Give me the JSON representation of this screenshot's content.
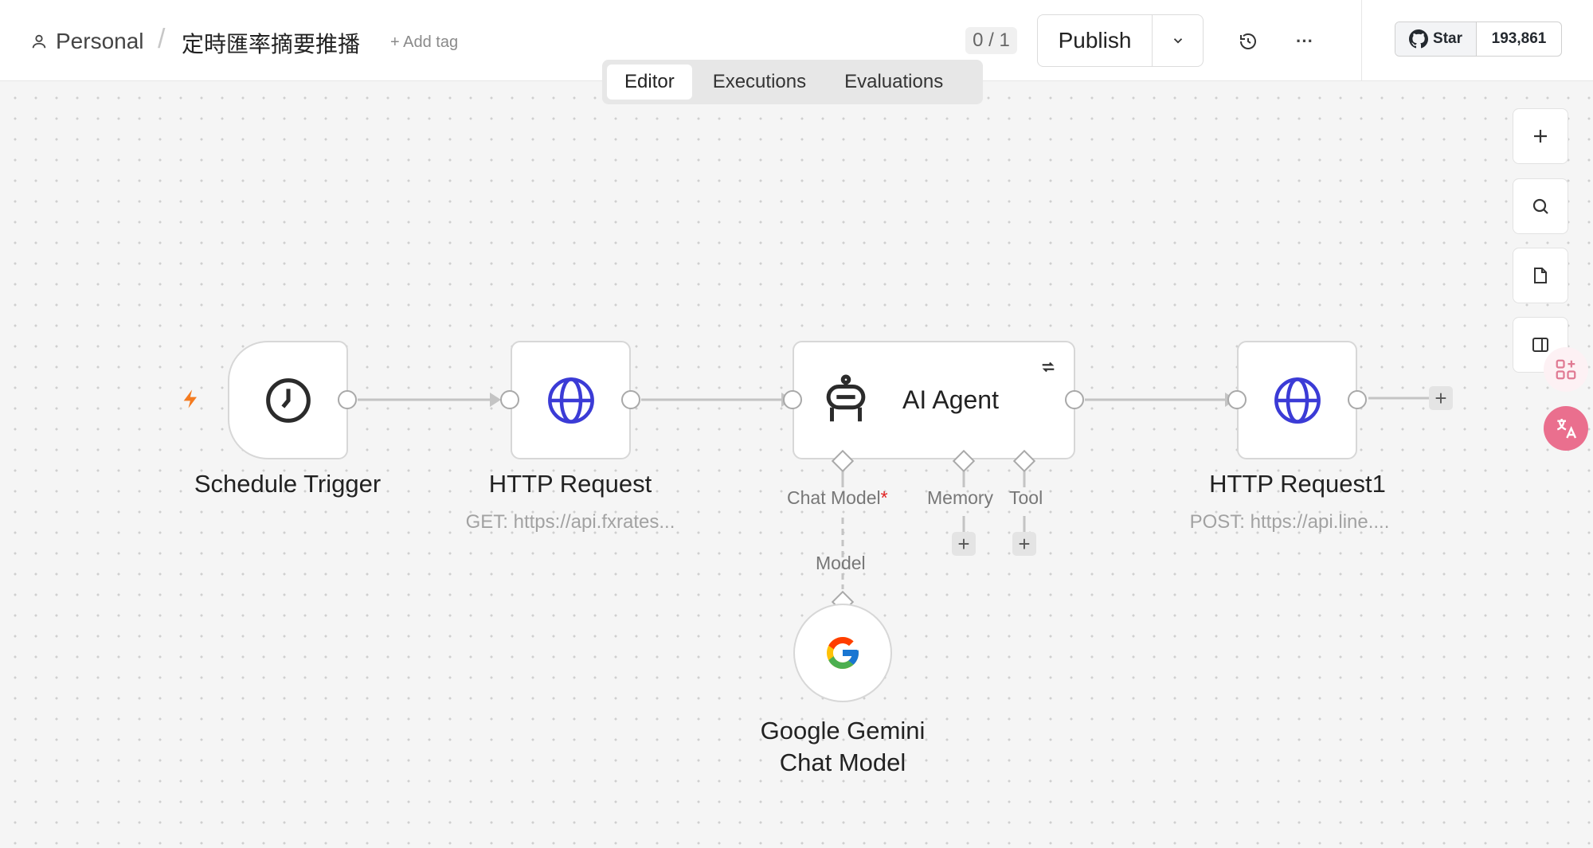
{
  "header": {
    "project": "Personal",
    "workflow_title": "定時匯率摘要推播",
    "add_tag": "+ Add tag",
    "counter": "0 / 1",
    "publish_label": "Publish",
    "more_label": "···",
    "github": {
      "star_label": "Star",
      "star_count": "193,861"
    }
  },
  "tabs": [
    {
      "label": "Editor",
      "active": true
    },
    {
      "label": "Executions",
      "active": false
    },
    {
      "label": "Evaluations",
      "active": false
    }
  ],
  "nodes": {
    "schedule": {
      "title": "Schedule Trigger",
      "icon": "clock-icon"
    },
    "http1": {
      "title": "HTTP Request",
      "subtitle": "GET: https://api.fxrates...",
      "icon": "globe-icon"
    },
    "agent": {
      "title": "AI Agent",
      "icon": "robot-icon"
    },
    "http2": {
      "title": "HTTP Request1",
      "subtitle": "POST: https://api.line....",
      "icon": "globe-icon"
    },
    "gemini": {
      "title_line1": "Google Gemini",
      "title_line2": "Chat Model",
      "icon": "google-icon"
    }
  },
  "connectors": {
    "chat_model": "Chat Model",
    "required_mark": "*",
    "memory": "Memory",
    "tool": "Tool",
    "model": "Model"
  },
  "colors": {
    "accent_globe": "#3b3bd6",
    "trigger_bolt": "#f47b20",
    "required": "#e02020"
  }
}
